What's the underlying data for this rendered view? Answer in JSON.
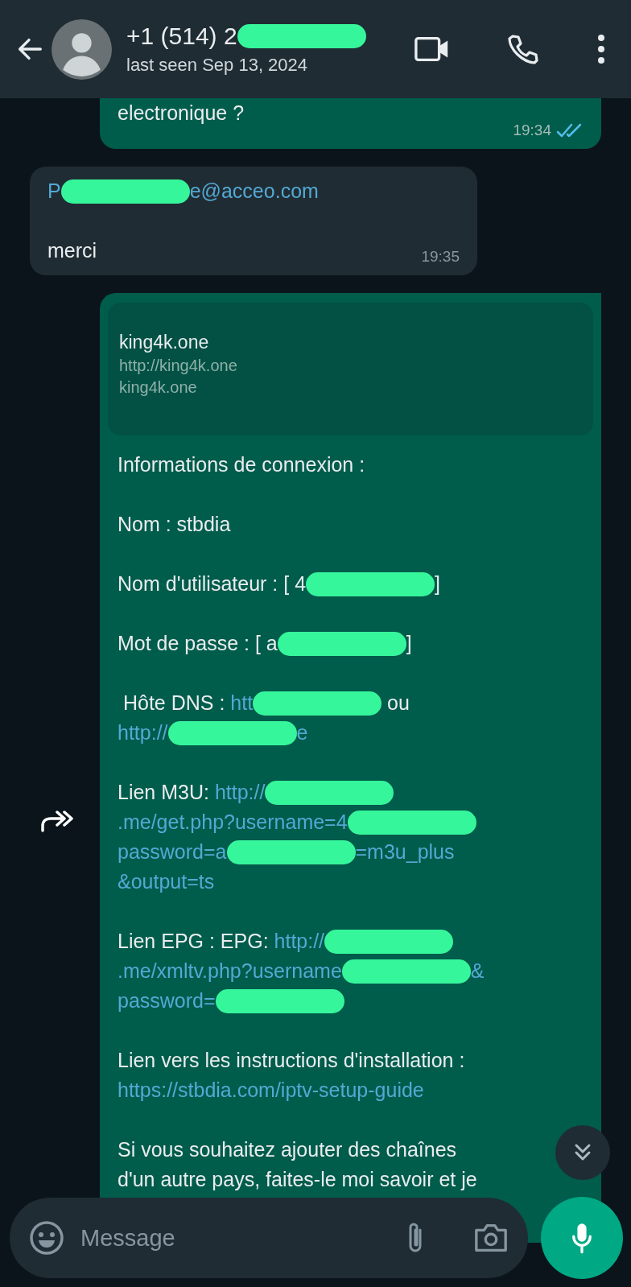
{
  "header": {
    "title_parts": [
      {
        "kind": "text",
        "text": "+1 (514) 2"
      },
      {
        "kind": "redaction"
      }
    ],
    "status": "last seen Sep 13, 2024"
  },
  "messages": [
    {
      "kind": "outgoing",
      "paragraphs": [
        [
          [
            {
              "kind": "text",
              "text": "electronique ?"
            }
          ]
        ]
      ],
      "time": "19:34",
      "read": true
    },
    {
      "kind": "incoming",
      "paragraphs": [
        [
          [
            {
              "kind": "link",
              "text": "P"
            },
            {
              "kind": "redaction"
            },
            {
              "kind": "link",
              "text": "e@acceo.com"
            }
          ]
        ],
        [
          [
            {
              "kind": "text",
              "text": "merci"
            }
          ]
        ]
      ],
      "time": "19:35"
    },
    {
      "kind": "outgoing",
      "forward": true,
      "preview": {
        "title": "king4k.one",
        "url": "http://king4k.one",
        "domain": "king4k.one"
      },
      "paragraphs": [
        [
          [
            {
              "kind": "text",
              "text": "Informations de connexion :"
            }
          ]
        ],
        [
          [
            {
              "kind": "text",
              "text": "Nom : stbdia"
            }
          ]
        ],
        [
          [
            {
              "kind": "text",
              "text": "Nom d'utilisateur : [ 4"
            },
            {
              "kind": "redaction"
            },
            {
              "kind": "text",
              "text": "]"
            }
          ]
        ],
        [
          [
            {
              "kind": "text",
              "text": "Mot de passe : [ a"
            },
            {
              "kind": "redaction"
            },
            {
              "kind": "text",
              "text": "]"
            }
          ]
        ],
        [
          [
            {
              "kind": "text",
              "text": " Hôte DNS : "
            },
            {
              "kind": "link",
              "text": "htt"
            },
            {
              "kind": "redaction"
            },
            {
              "kind": "text",
              "text": " ou"
            }
          ],
          [
            {
              "kind": "link",
              "text": "http://"
            },
            {
              "kind": "redaction"
            },
            {
              "kind": "link",
              "text": "e"
            }
          ]
        ],
        [
          [
            {
              "kind": "text",
              "text": "Lien M3U: "
            },
            {
              "kind": "link",
              "text": "http://"
            },
            {
              "kind": "redaction"
            }
          ],
          [
            {
              "kind": "link",
              "text": ".me/get.php?username=4"
            },
            {
              "kind": "redaction"
            }
          ],
          [
            {
              "kind": "link",
              "text": "password=a"
            },
            {
              "kind": "redaction"
            },
            {
              "kind": "link",
              "text": "=m3u_plus"
            }
          ],
          [
            {
              "kind": "link",
              "text": "&output=ts"
            }
          ]
        ],
        [
          [
            {
              "kind": "text",
              "text": "Lien EPG : EPG: "
            },
            {
              "kind": "link",
              "text": "http://"
            },
            {
              "kind": "redaction"
            }
          ],
          [
            {
              "kind": "link",
              "text": ".me/xmltv.php?username"
            },
            {
              "kind": "redaction"
            },
            {
              "kind": "link",
              "text": "&"
            }
          ],
          [
            {
              "kind": "link",
              "text": "password="
            },
            {
              "kind": "redaction"
            }
          ]
        ],
        [
          [
            {
              "kind": "text",
              "text": "Lien vers les instructions d'installation :"
            }
          ],
          [
            {
              "kind": "link",
              "text": "https://stbdia.com/iptv-setup-guide"
            }
          ]
        ],
        [
          [
            {
              "kind": "text",
              "text": "Si vous souhaitez ajouter des chaînes"
            }
          ],
          [
            {
              "kind": "text",
              "text": "d'un autre pays, faites-le moi savoir et je"
            }
          ]
        ]
      ]
    }
  ],
  "composer": {
    "placeholder": "Message"
  }
}
